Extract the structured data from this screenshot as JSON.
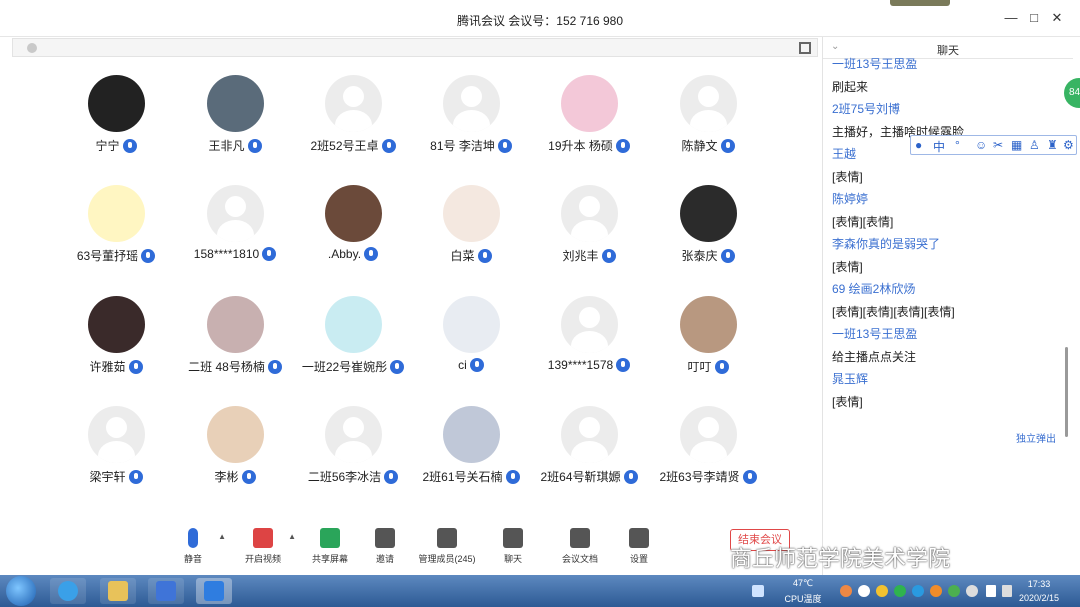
{
  "window": {
    "title": "腾讯会议 会议号：152 716 980"
  },
  "participants": [
    {
      "name": "宁宁"
    },
    {
      "name": "王非凡"
    },
    {
      "name": "2班52号王卓"
    },
    {
      "name": "81号 李洁坤"
    },
    {
      "name": "19升本  杨硕"
    },
    {
      "name": "陈静文"
    },
    {
      "name": "63号董抒瑶"
    },
    {
      "name": "158****1810"
    },
    {
      "name": ".Abby."
    },
    {
      "name": "白菜"
    },
    {
      "name": "刘兆丰"
    },
    {
      "name": "张泰庆"
    },
    {
      "name": "许雅茹"
    },
    {
      "name": "二班 48号杨楠"
    },
    {
      "name": "一班22号崔婉彤"
    },
    {
      "name": "ci"
    },
    {
      "name": "139****1578"
    },
    {
      "name": "叮叮"
    },
    {
      "name": "梁宇轩"
    },
    {
      "name": "李彬"
    },
    {
      "name": "二班56李冰洁"
    },
    {
      "name": "2班61号关石楠"
    },
    {
      "name": "2班64号靳琪嫄"
    },
    {
      "name": "2班63号李靖贤"
    }
  ],
  "toolbar": {
    "mute": "静音",
    "video": "开启视频",
    "share": "共享屏幕",
    "invite": "邀请",
    "members": "管理成员(245)",
    "chat": "聊天",
    "docs": "会议文档",
    "settings": "设置",
    "leave": "结束会议"
  },
  "chat": {
    "title": "聊天",
    "messages": [
      {
        "type": "sender",
        "text": "一班13号王思盈"
      },
      {
        "type": "body",
        "text": "刷起来"
      },
      {
        "type": "sender",
        "text": "2班75号刘博"
      },
      {
        "type": "body",
        "text": "主播好，主播啥时候露脸"
      },
      {
        "type": "sender",
        "text": "王越"
      },
      {
        "type": "body",
        "text": "[表情]"
      },
      {
        "type": "sender",
        "text": "陈婷婷"
      },
      {
        "type": "body",
        "text": "[表情][表情]"
      },
      {
        "type": "sender",
        "text": "李森你真的是弱哭了"
      },
      {
        "type": "body",
        "text": "[表情]"
      },
      {
        "type": "sender",
        "text": "69  绘画2林欣炀"
      },
      {
        "type": "body",
        "text": "[表情][表情][表情][表情]"
      },
      {
        "type": "sender",
        "text": "一班13号王思盈"
      },
      {
        "type": "body",
        "text": "给主播点点关注"
      },
      {
        "type": "sender",
        "text": "晁玉辉"
      },
      {
        "type": "body",
        "text": "[表情]"
      }
    ],
    "popout": "独立弹出"
  },
  "ime": {
    "lang": "中"
  },
  "badge": "84",
  "watermark": "商丘师范学院美术学院",
  "tray": {
    "temp": "47℃",
    "cpu": "CPU温度",
    "time": "17:33",
    "date": "2020/2/15"
  },
  "colors": {
    "accent": "#2f6bd8",
    "sender": "#3a6fd0",
    "leave": "#e04848",
    "taskbar": "#2d5a94"
  }
}
